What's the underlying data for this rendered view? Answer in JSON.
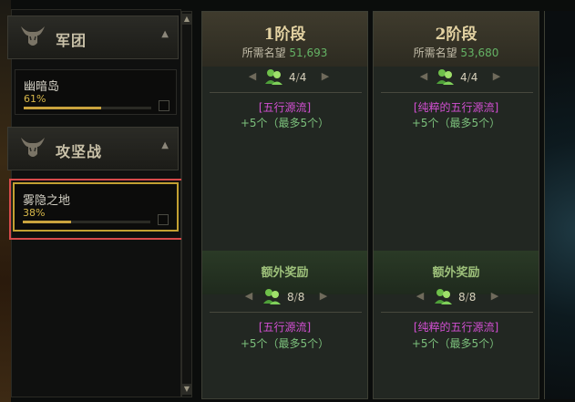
{
  "sidebar": {
    "categories": [
      {
        "title": "军团",
        "icon": "horned-helmet-icon"
      },
      {
        "title": "攻坚战",
        "icon": "horned-helmet-icon"
      }
    ],
    "zones": [
      {
        "name": "幽暗岛",
        "percent": "61%",
        "progress": 0.61
      },
      {
        "name": "雾隐之地",
        "percent": "38%",
        "progress": 0.38
      }
    ]
  },
  "stages": [
    {
      "title": "1阶段",
      "req_label": "所需名望",
      "req_value": "51,693",
      "count": "4",
      "count_total": "4",
      "reward_name": "[五行源流]",
      "reward_amount": "+5个（最多5个）",
      "bonus_title": "额外奖励",
      "bonus_count": "8",
      "bonus_total": "8",
      "bonus_reward_name": "[五行源流]",
      "bonus_reward_amount": "+5个（最多5个）"
    },
    {
      "title": "2阶段",
      "req_label": "所需名望",
      "req_value": "53,680",
      "count": "4",
      "count_total": "4",
      "reward_name": "[纯粹的五行源流]",
      "reward_amount": "+5个（最多5个）",
      "bonus_title": "额外奖励",
      "bonus_count": "8",
      "bonus_total": "8",
      "bonus_reward_name": "[纯粹的五行源流]",
      "bonus_reward_amount": "+5个（最多5个）"
    }
  ],
  "colors": {
    "accent_gold": "#c9a33e",
    "highlight_red": "#d74a4a",
    "reward_magenta": "#d24fd2",
    "reward_green": "#7cc07c"
  }
}
